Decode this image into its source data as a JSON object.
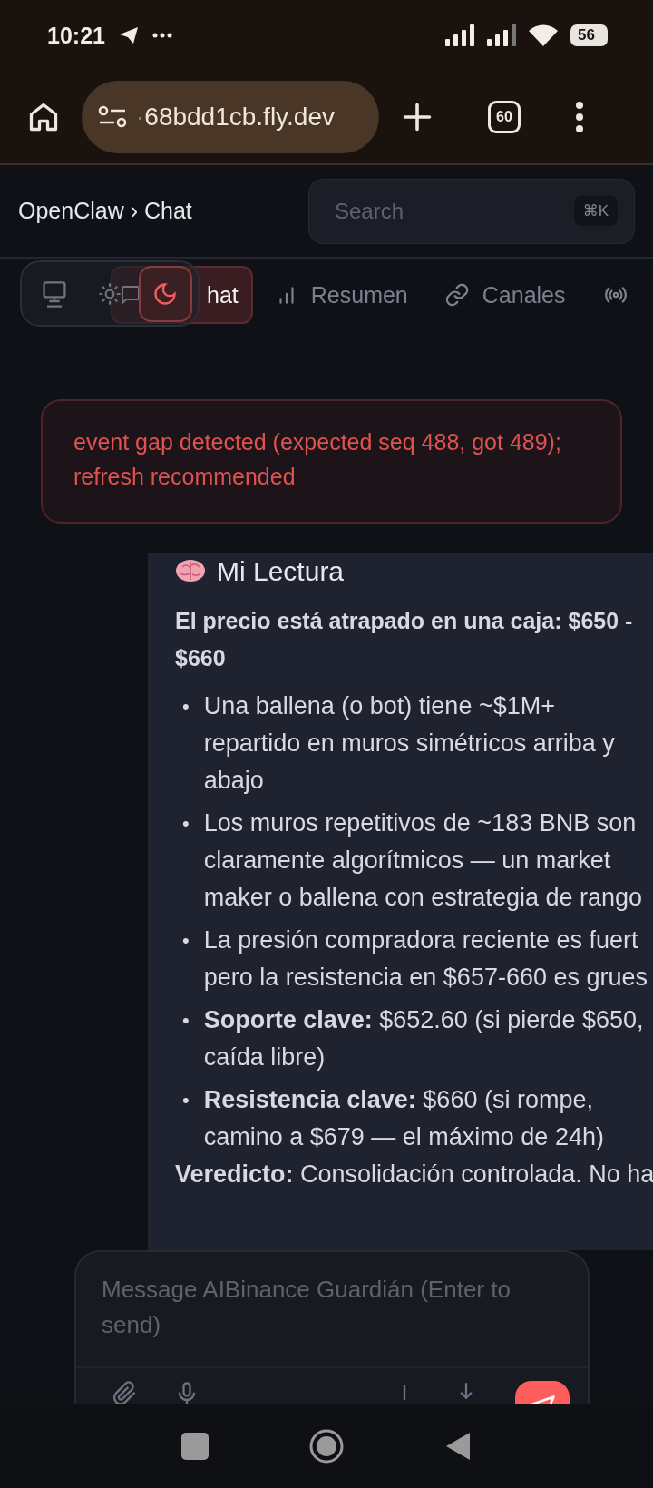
{
  "status_bar": {
    "time": "10:21",
    "battery": "56"
  },
  "browser": {
    "url_faded": "·",
    "url": "68bdd1cb.fly.dev",
    "tab_count": "60"
  },
  "header": {
    "breadcrumb": "OpenClaw › Chat",
    "search": {
      "placeholder": "Search",
      "shortcut": "⌘K"
    }
  },
  "tabs": [
    {
      "label": "hat",
      "kind": "chat",
      "selected": true
    },
    {
      "label": "Resumen",
      "kind": "stats",
      "selected": false
    },
    {
      "label": "Canales",
      "kind": "link",
      "selected": false
    },
    {
      "kind": "broadcast",
      "selected": false
    }
  ],
  "theme_toggle": [
    {
      "kind": "system",
      "selected": false
    },
    {
      "kind": "light",
      "selected": false
    },
    {
      "kind": "dark",
      "selected": true
    }
  ],
  "alert": {
    "text": "event gap detected (expected seq 488, got 489); refresh recommended"
  },
  "message": {
    "heading": "Mi Lectura",
    "marker": "•",
    "lead": [
      "El precio está atrapado en una caja: $650 -",
      "$660"
    ],
    "bullets": [
      [
        "Una ballena (o bot) tiene ~$1M+",
        "repartido en muros simétricos arriba y",
        "abajo"
      ],
      [
        "Los muros repetitivos de ~183 BNB son",
        "claramente algorítmicos — un market",
        "maker o ballena con estrategia de rango"
      ],
      [
        "La presión compradora reciente es fuert",
        "pero la resistencia en $657-660 es grues"
      ],
      [
        "**Soporte clave:** $652.60 (si pierde $650,",
        "caída libre)"
      ],
      [
        "**Resistencia clave:** $660 (si rompe,",
        "camino a $679 — el máximo de 24h)"
      ]
    ],
    "verdict": "**Veredicto:** Consolidación controlada. No ha"
  },
  "composer": {
    "placeholder": "Message AIBinance Guardián (Enter to send)"
  }
}
